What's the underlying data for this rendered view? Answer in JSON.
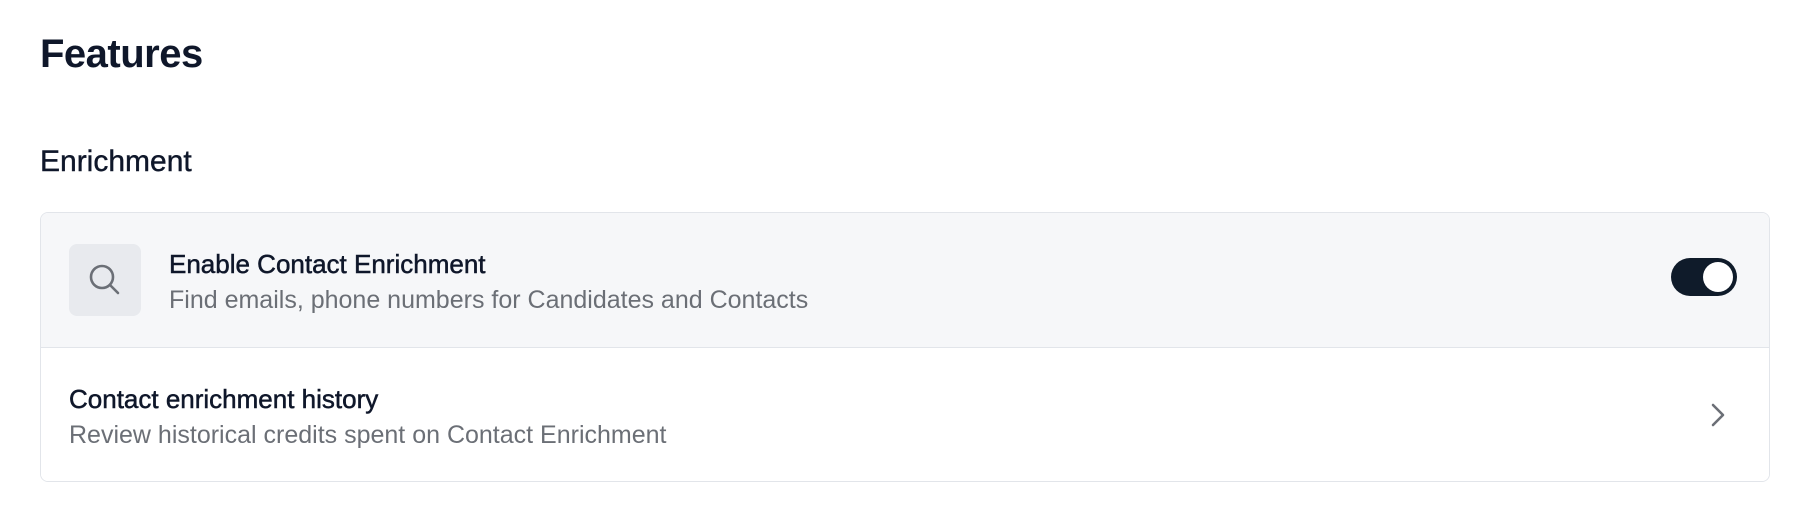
{
  "page": {
    "title": "Features"
  },
  "section": {
    "title": "Enrichment"
  },
  "enrichment_toggle": {
    "icon": "search-icon",
    "title": "Enable Contact Enrichment",
    "subtitle": "Find emails, phone numbers for Candidates and Contacts",
    "enabled": true
  },
  "history_link": {
    "title": "Contact enrichment history",
    "subtitle": "Review historical credits spent on Contact Enrichment",
    "icon": "chevron-right-icon"
  },
  "colors": {
    "text_primary": "#0f172a",
    "text_secondary": "#6b6f76",
    "toggle_on": "#0f1b2a",
    "row_highlight": "#f6f7f9",
    "border": "#e2e5ea"
  }
}
